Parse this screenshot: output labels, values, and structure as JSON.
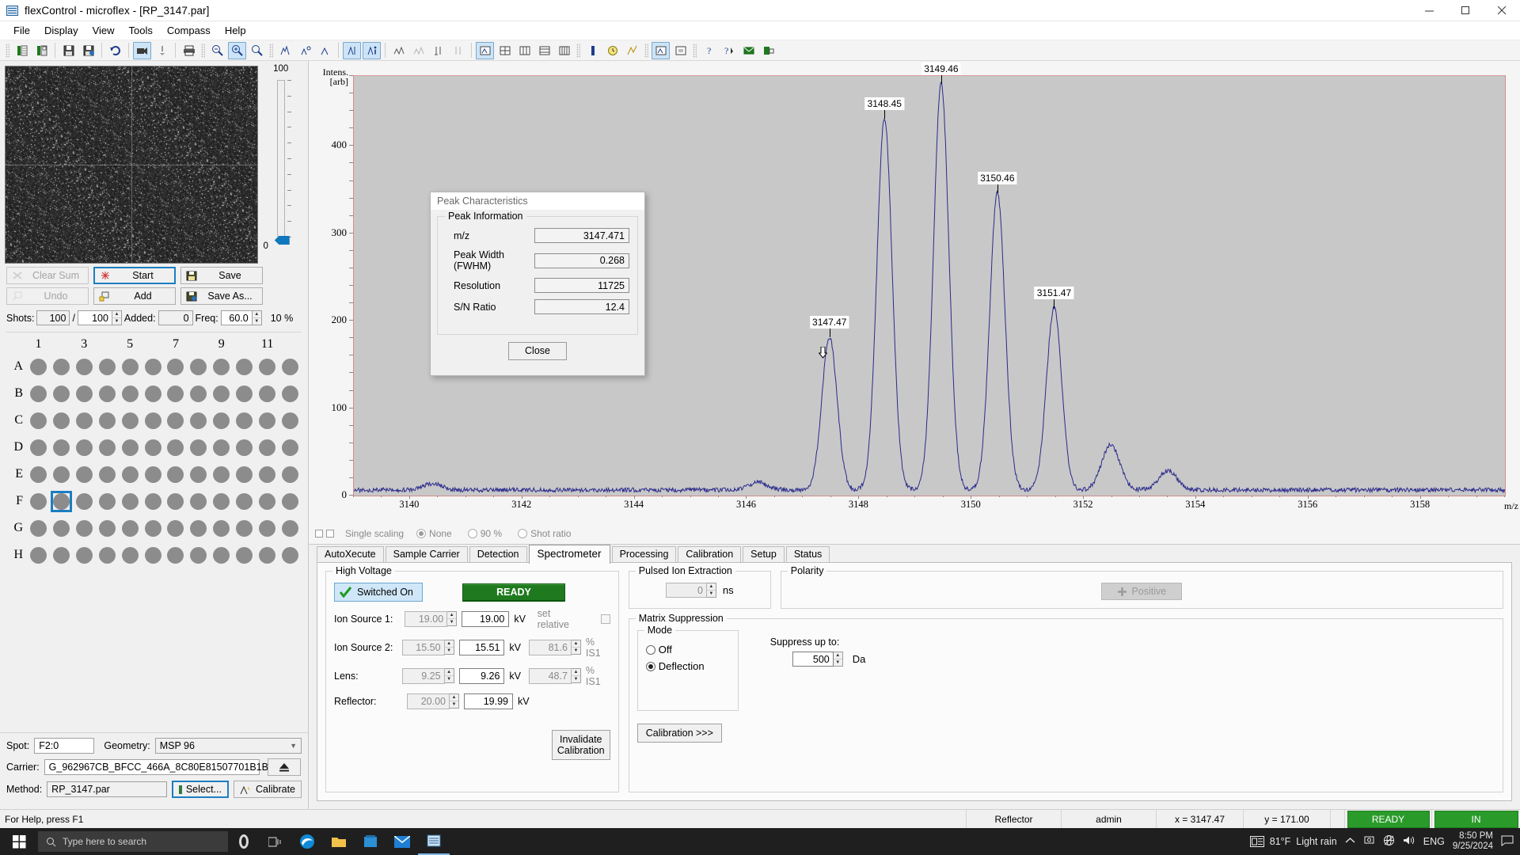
{
  "window": {
    "title": "flexControl - microflex - [RP_3147.par]",
    "icon": "app-icon",
    "minimize": "minimize-icon",
    "maximize": "maximize-icon",
    "close": "close-icon"
  },
  "menubar": {
    "items": [
      "File",
      "Display",
      "View",
      "Tools",
      "Compass",
      "Help"
    ]
  },
  "left_panel": {
    "camera": {
      "scale_top": "100",
      "scale_bottom": "0"
    },
    "buttons": {
      "clear_sum": "Clear Sum",
      "start": "Start",
      "save": "Save",
      "undo": "Undo",
      "add": "Add",
      "save_as": "Save As..."
    },
    "shots": {
      "label": "Shots:",
      "current": "100",
      "separator": "/",
      "total": "100",
      "added_label": "Added:",
      "added": "0",
      "freq_label": "Freq:",
      "freq": "60.0",
      "percent": "10 %"
    },
    "plate": {
      "col_labels": [
        "1",
        "",
        "3",
        "",
        "5",
        "",
        "7",
        "",
        "9",
        "",
        "11",
        ""
      ],
      "row_labels": [
        "A",
        "B",
        "C",
        "D",
        "E",
        "F",
        "G",
        "H"
      ],
      "columns": 12,
      "selected": {
        "row": "F",
        "col": 2
      }
    },
    "fields": {
      "spot_label": "Spot:",
      "spot_value": "F2:0",
      "geometry_label": "Geometry:",
      "geometry_value": "MSP 96",
      "carrier_label": "Carrier:",
      "carrier_value": "G_962967CB_BFCC_466A_8C80E81507701B1B",
      "eject_icon": "eject-icon",
      "method_label": "Method:",
      "method_value": "RP_3147.par",
      "select_button": "Select...",
      "calibrate_button": "Calibrate"
    }
  },
  "chart_data": {
    "type": "line",
    "title": "",
    "xlabel": "m/z",
    "ylabel": "Intens.\n[arb]",
    "ylabel_line1": "Intens.",
    "ylabel_line2": "[arb]",
    "xlim": [
      3139.0,
      3159.5
    ],
    "ylim": [
      0,
      480
    ],
    "xticks": [
      3140,
      3142,
      3144,
      3146,
      3148,
      3150,
      3152,
      3154,
      3156,
      3158
    ],
    "yticks": [
      100,
      200,
      300,
      400
    ],
    "grid": false,
    "series_color": "#2a2a8c",
    "annotations": [
      {
        "label": "3147.47",
        "x": 3147.47,
        "y": 175
      },
      {
        "label": "3148.45",
        "x": 3148.45,
        "y": 425
      },
      {
        "label": "3149.46",
        "x": 3149.46,
        "y": 465
      },
      {
        "label": "3150.46",
        "x": 3150.46,
        "y": 340
      },
      {
        "label": "3151.47",
        "x": 3151.47,
        "y": 208
      }
    ],
    "peaks": [
      {
        "x": 3147.47,
        "y": 175
      },
      {
        "x": 3148.45,
        "y": 425
      },
      {
        "x": 3149.46,
        "y": 465
      },
      {
        "x": 3150.46,
        "y": 340
      },
      {
        "x": 3151.47,
        "y": 208
      },
      {
        "x": 3152.48,
        "y": 52
      },
      {
        "x": 3153.5,
        "y": 22
      },
      {
        "x": 3146.2,
        "y": 9
      },
      {
        "x": 3140.4,
        "y": 7
      }
    ],
    "baseline": 4
  },
  "scaling": {
    "label": "Single scaling",
    "options": [
      "None",
      "90 %",
      "Shot ratio"
    ],
    "selected": "None"
  },
  "tabs": {
    "items": [
      "AutoXecute",
      "Sample Carrier",
      "Detection",
      "Spectrometer",
      "Processing",
      "Calibration",
      "Setup",
      "Status"
    ],
    "active": "Spectrometer"
  },
  "spectrometer": {
    "high_voltage": {
      "title": "High Voltage",
      "switched_label": "Switched On",
      "status": "READY",
      "status_color": "#1f7a1f",
      "rows": [
        {
          "label": "Ion Source 1:",
          "set": "19.00",
          "actual": "19.00",
          "unit": "kV",
          "pct": "",
          "pct_unit": ""
        },
        {
          "label": "Ion Source 2:",
          "set": "15.50",
          "actual": "15.51",
          "unit": "kV",
          "pct": "81.6",
          "pct_unit": "% IS1"
        },
        {
          "label": "Lens:",
          "set": "9.25",
          "actual": "9.26",
          "unit": "kV",
          "pct": "48.7",
          "pct_unit": "% IS1"
        },
        {
          "label": "Reflector:",
          "set": "20.00",
          "actual": "19.99",
          "unit": "kV",
          "pct": "",
          "pct_unit": ""
        }
      ],
      "set_relative_label": "set relative",
      "invalidate_line1": "Invalidate",
      "invalidate_line2": "Calibration"
    },
    "pulsed_ion_extraction": {
      "title": "Pulsed Ion Extraction",
      "value": "0",
      "unit": "ns"
    },
    "polarity": {
      "title": "Polarity",
      "value": "Positive"
    },
    "matrix_suppression": {
      "title": "Matrix Suppression",
      "mode_title": "Mode",
      "modes": [
        "Off",
        "Deflection"
      ],
      "selected_mode": "Deflection",
      "suppress_label": "Suppress up to:",
      "suppress_value": "500",
      "suppress_unit": "Da",
      "calibration_button": "Calibration >>>"
    }
  },
  "dialog": {
    "title": "Peak Characteristics",
    "group_title": "Peak Information",
    "rows": [
      {
        "label": "m/z",
        "value": "3147.471"
      },
      {
        "label": "Peak Width (FWHM)",
        "value": "0.268"
      },
      {
        "label": "Resolution",
        "value": "11725"
      },
      {
        "label": "S/N Ratio",
        "value": "12.4"
      }
    ],
    "close_button": "Close"
  },
  "statusbar": {
    "help": "For Help, press F1",
    "mode": "Reflector",
    "user": "admin",
    "x": "x = 3147.47",
    "y": "y = 171.00",
    "ready": "READY",
    "in": "IN"
  },
  "taskbar": {
    "search_placeholder": "Type here to search",
    "weather_temp": "81°F",
    "weather_desc": "Light rain",
    "language": "ENG",
    "time": "8:50 PM",
    "date": "9/25/2024"
  }
}
